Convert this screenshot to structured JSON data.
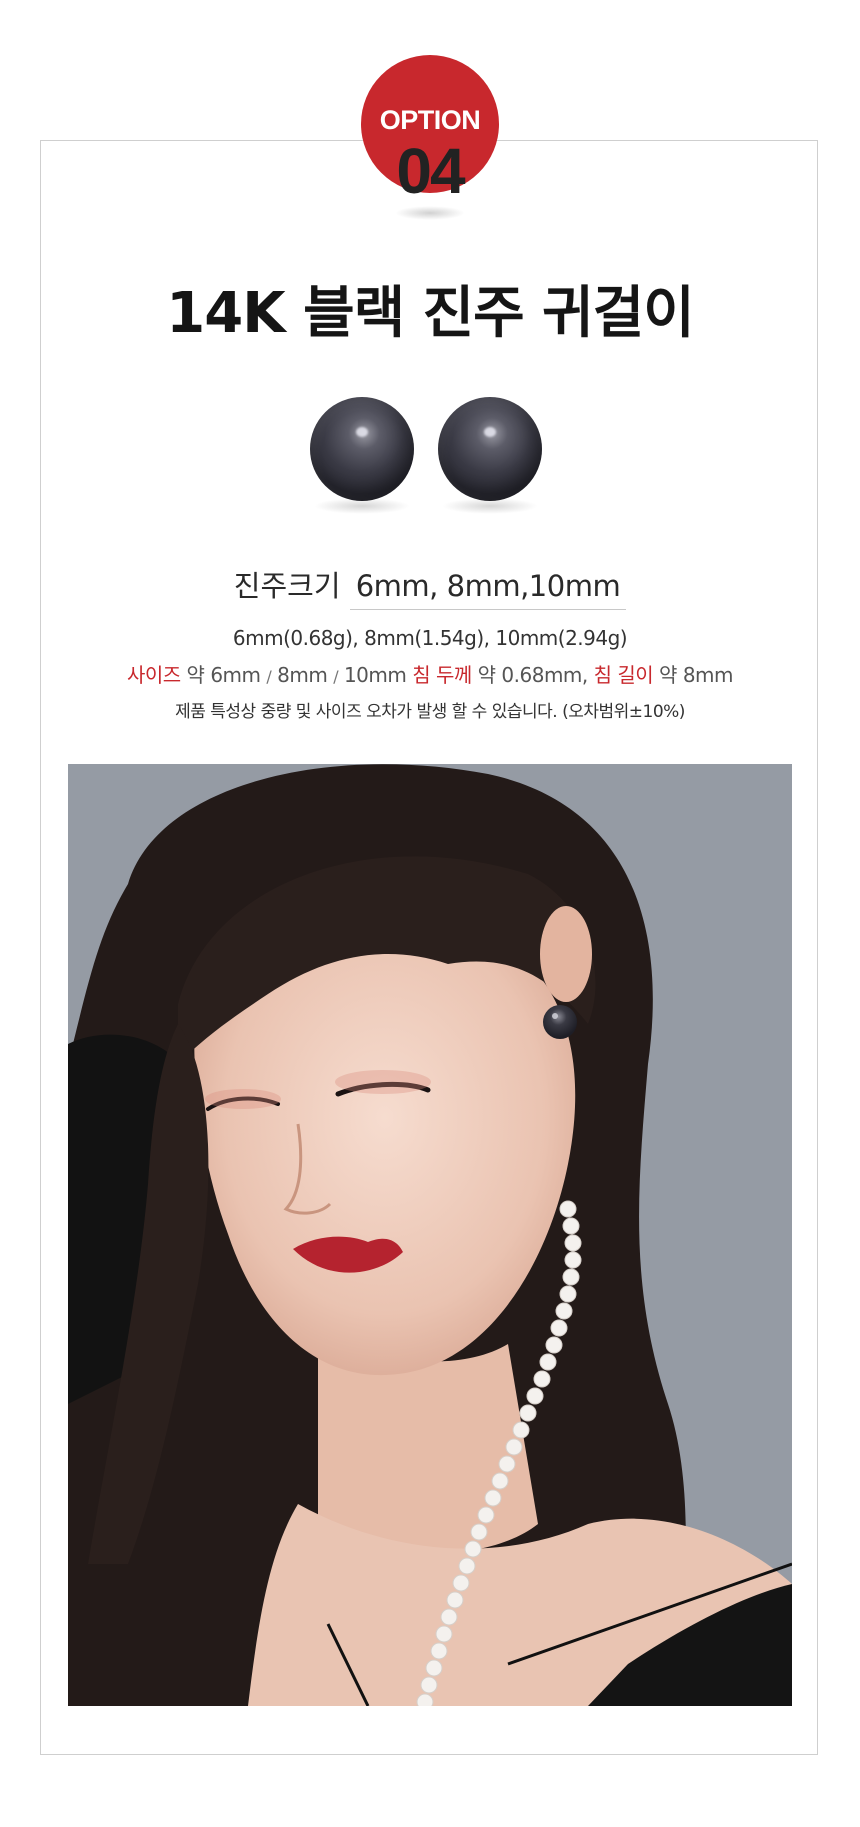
{
  "colors": {
    "badge": "#c8282d",
    "accent_red": "#c8282d",
    "frame_border": "#cfcfcf",
    "pearl": "#3a3a44"
  },
  "badge": {
    "label": "OPTION",
    "number": "04"
  },
  "product": {
    "title": "14K 블랙 진주 귀걸이"
  },
  "pearl_size": {
    "label": "진주크기",
    "value": "6mm, 8mm,10mm"
  },
  "weights": "6mm(0.68g), 8mm(1.54g), 10mm(2.94g)",
  "specs": {
    "size_label": "사이즈",
    "approx1": "약",
    "size_a": "6mm",
    "slash1": "/",
    "size_b": "8mm",
    "slash2": "/",
    "size_c": "10mm",
    "thickness_label": "침 두께",
    "approx2": "약",
    "thickness_value": "0.68mm,",
    "length_label": "침 길이",
    "approx3": "약",
    "length_value": "8mm"
  },
  "note": "제품 특성상 중량 및 사이즈 오차가 발생 할 수 있습니다. (오차범위±10%)",
  "photo": {
    "subject": "model wearing black pearl stud earring and white pearl necklace"
  }
}
